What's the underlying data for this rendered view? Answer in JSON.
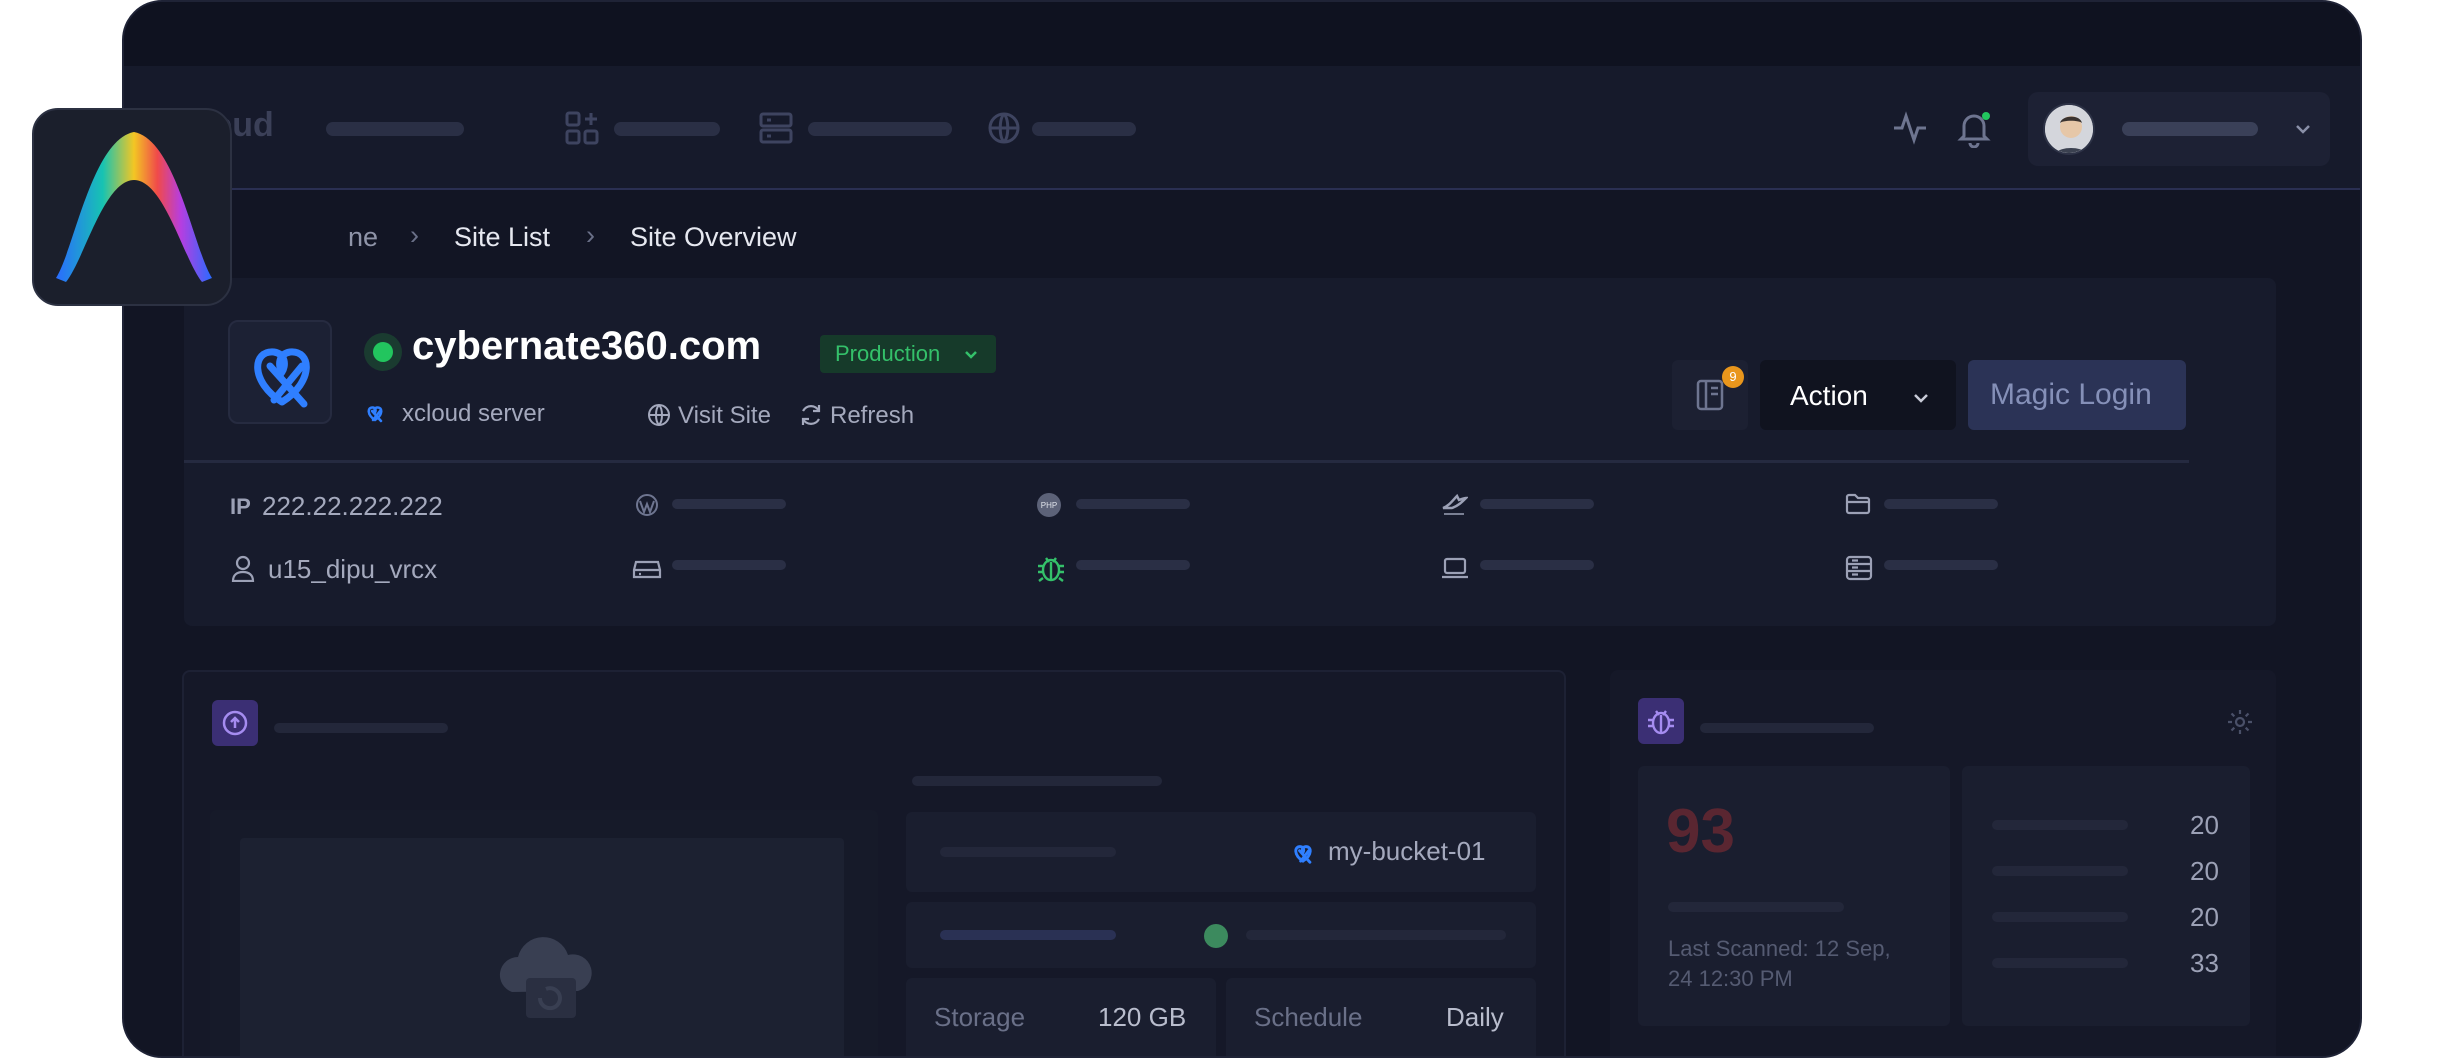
{
  "app": {
    "brand_partial": "loud"
  },
  "breadcrumb": {
    "home_partial": "ne",
    "site_list": "Site List",
    "current": "Site Overview"
  },
  "site": {
    "name": "cybernate360.com",
    "environment": "Production",
    "server": "xcloud server",
    "visit_label": "Visit Site",
    "refresh_label": "Refresh",
    "notes_count": "9",
    "action_label": "Action",
    "magic_login_label": "Magic Login",
    "ip_prefix": "IP",
    "ip": "222.22.222.222",
    "user": "u15_dipu_vrcx"
  },
  "backup": {
    "bucket": "my-bucket-01",
    "storage_label": "Storage",
    "storage_value": "120 GB",
    "schedule_label": "Schedule",
    "schedule_value": "Daily"
  },
  "security": {
    "score": "93",
    "last_scanned": "Last Scanned: 12 Sep,",
    "last_scanned_time": "24 12:30 PM",
    "counts": [
      "20",
      "20",
      "20",
      "33"
    ]
  },
  "colors": {
    "accent_green": "#22c55e",
    "accent_blue": "#2f7fff",
    "badge_orange": "#e9961c",
    "score_red": "#5a2631"
  }
}
